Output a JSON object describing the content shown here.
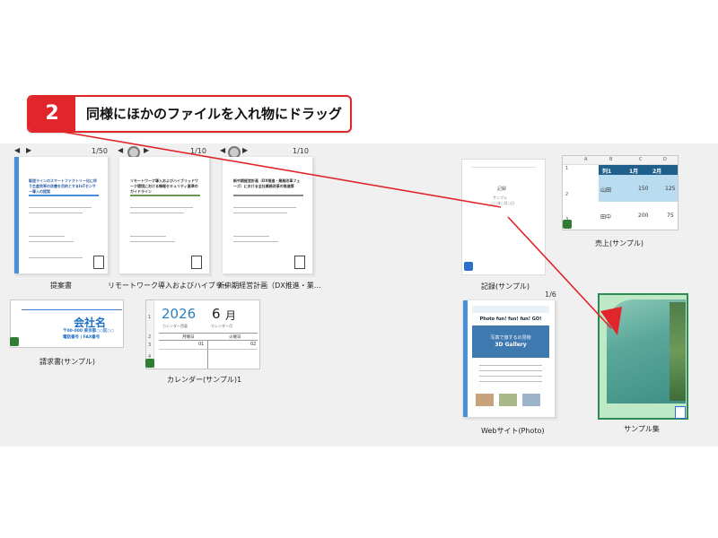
{
  "callout": {
    "number": "2",
    "text": "同様にほかのファイルを入れ物にドラッグ"
  },
  "nav": {
    "prev": "◀",
    "next": "▶"
  },
  "stack1": {
    "pager": "1/50",
    "label": "提案書",
    "title": "製造ラインのスマートファクトリー化に伴う生産効率の改善を目的とするIoTセンサー導入の提案"
  },
  "stack2": {
    "pager": "1/10",
    "label": "リモートワーク導入およびハイブリッ…",
    "title": "リモートワーク導入およびハイブリッドワーク環境における情報セキュリティ基準のガイドライン"
  },
  "stack3": {
    "pager": "1/10",
    "label": "新中期経営計画（DX推進・業…",
    "title": "新中期経営計画（DX推進・業務改革フェーズ）における全社業務改革の推進策"
  },
  "invoice": {
    "company": "会社名",
    "lines": [
      "〒00-000 東京都○○区○○",
      "電話番号 | FAX番号"
    ],
    "label": "請求書(サンプル)"
  },
  "calendar": {
    "year": "2026",
    "month": "6",
    "month_unit": "月",
    "year_caption": "カレンダー西暦",
    "month_caption": "カレンダー月",
    "days": [
      "月曜日",
      "火曜日"
    ],
    "dates": [
      "01",
      "02"
    ],
    "rows": [
      "1",
      "2",
      "3",
      "4"
    ],
    "label": "カレンダー(サンプル)1"
  },
  "record": {
    "label": "記録(サンプル)",
    "center": "記録",
    "lines": [
      "サンプル",
      "○○年○月○日"
    ]
  },
  "sales": {
    "label": "売上(サンプル)",
    "cols": [
      "A",
      "B",
      "C",
      "D"
    ],
    "rows": [
      "1",
      "2",
      "3"
    ],
    "h1": "列1",
    "h2": "1月",
    "h3": "2月",
    "r1": [
      "山田",
      "150",
      "125"
    ],
    "r2": [
      "田中",
      "200",
      "75"
    ]
  },
  "web": {
    "pager": "1/6",
    "label": "Webサイト(Photo)",
    "heading": "Photo fun! fun! fun! GO!",
    "banner1": "写真で旅するの見物",
    "banner2": "3D Gallery"
  },
  "sample": {
    "label": "サンプル集"
  }
}
